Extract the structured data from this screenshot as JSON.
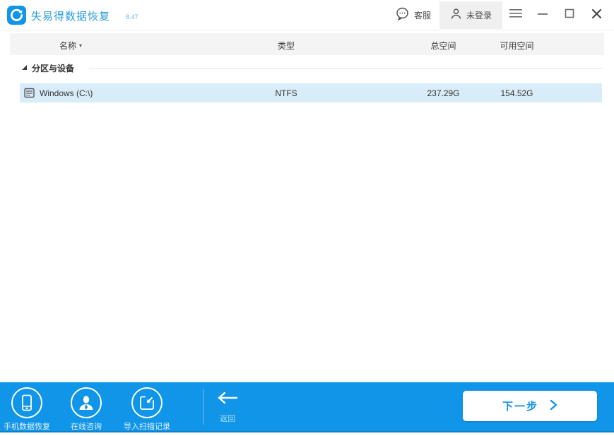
{
  "window": {
    "title": "失易得数据恢复",
    "version": "8.47",
    "controls": {
      "support_label": "客服",
      "login_label": "未登录"
    }
  },
  "table": {
    "headers": {
      "name": "名称",
      "type": "类型",
      "total": "总空间",
      "free": "可用空间"
    },
    "sort_indicator": "▾",
    "group_label": "分区与设备",
    "rows": [
      {
        "name": "Windows (C:\\)",
        "type": "NTFS",
        "total": "237.29G",
        "free": "154.52G"
      }
    ]
  },
  "toolbar": {
    "items": [
      {
        "label": "手机数据恢复",
        "icon": "phone-recovery-icon"
      },
      {
        "label": "在线咨询",
        "icon": "online-consult-icon"
      },
      {
        "label": "导入扫描记录",
        "icon": "import-scan-icon"
      }
    ],
    "back_label": "返回",
    "next_label": "下一步"
  },
  "colors": {
    "accent_blue": "#1095e8",
    "toolbar_border": "#0c82cf",
    "row_highlight": "#d9ecf9",
    "header_bg": "#f4f4f4",
    "title_blue": "#2b9bd8"
  }
}
